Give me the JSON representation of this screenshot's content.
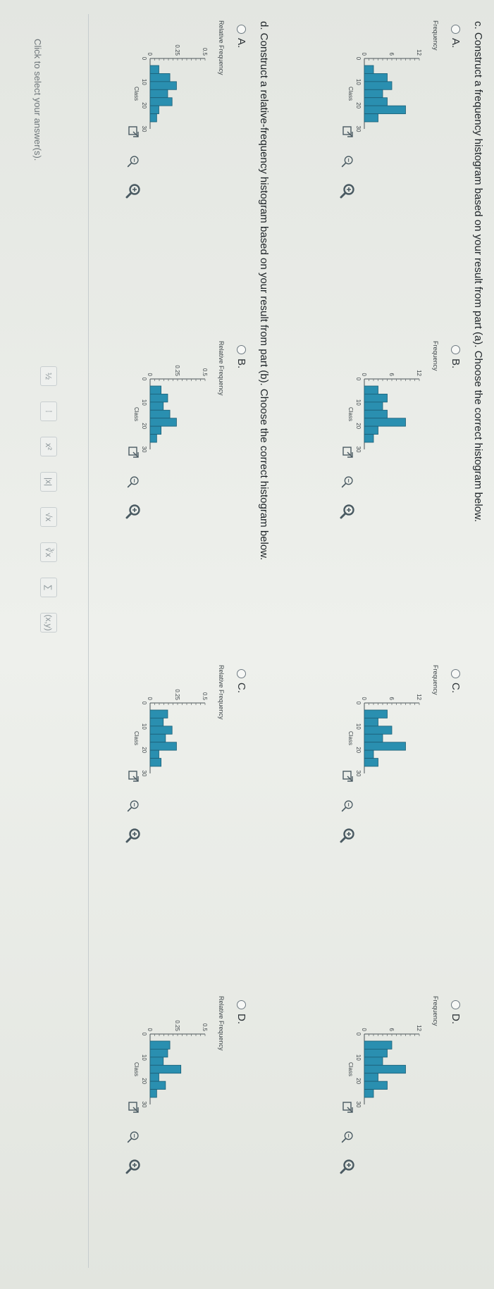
{
  "partC": {
    "question": "c. Construct a frequency histogram based on your result from part (a). Choose the correct histogram below.",
    "options": [
      {
        "letter": "A.",
        "ylabel": "Frequency",
        "yticks": [
          "12",
          "6",
          "0"
        ],
        "xticks": [
          "0",
          "10",
          "20",
          "30"
        ],
        "xlabel": "Class",
        "values": [
          2,
          5,
          6,
          4,
          5,
          9,
          3
        ]
      },
      {
        "letter": "B.",
        "ylabel": "Frequency",
        "yticks": [
          "12",
          "6",
          "0"
        ],
        "xticks": [
          "0",
          "10",
          "20",
          "30"
        ],
        "xlabel": "Class",
        "values": [
          3,
          5,
          4,
          5,
          9,
          3,
          2
        ]
      },
      {
        "letter": "C.",
        "ylabel": "Frequency",
        "yticks": [
          "12",
          "6",
          "0"
        ],
        "xticks": [
          "0",
          "10",
          "20",
          "30"
        ],
        "xlabel": "Class",
        "values": [
          5,
          3,
          6,
          4,
          9,
          2,
          3
        ]
      },
      {
        "letter": "D.",
        "ylabel": "Frequency",
        "yticks": [
          "12",
          "6",
          "0"
        ],
        "xticks": [
          "0",
          "10",
          "20",
          "30"
        ],
        "xlabel": "Class",
        "values": [
          6,
          5,
          4,
          9,
          3,
          5,
          2
        ]
      }
    ]
  },
  "partD": {
    "question": "d. Construct a relative-frequency histogram based on your result from part (b). Choose the correct histogram below.",
    "options": [
      {
        "letter": "A.",
        "ylabel": "Relative Frequency",
        "yticks": [
          "0.5",
          "0.25",
          "0"
        ],
        "xticks": [
          "0",
          "10",
          "20",
          "30"
        ],
        "xlabel": "Class",
        "values": [
          0.08,
          0.18,
          0.24,
          0.16,
          0.2,
          0.08,
          0.06
        ]
      },
      {
        "letter": "B.",
        "ylabel": "Relative Frequency",
        "yticks": [
          "0.5",
          "0.25",
          "0"
        ],
        "xticks": [
          "0",
          "10",
          "20",
          "30"
        ],
        "xlabel": "Class",
        "values": [
          0.1,
          0.16,
          0.12,
          0.18,
          0.24,
          0.1,
          0.06
        ]
      },
      {
        "letter": "C.",
        "ylabel": "Relative Frequency",
        "yticks": [
          "0.5",
          "0.25",
          "0"
        ],
        "xticks": [
          "0",
          "10",
          "20",
          "30"
        ],
        "xlabel": "Class",
        "values": [
          0.16,
          0.12,
          0.2,
          0.14,
          0.24,
          0.08,
          0.1
        ]
      },
      {
        "letter": "D.",
        "ylabel": "Relative Frequency",
        "yticks": [
          "0.5",
          "0.25",
          "0"
        ],
        "xticks": [
          "0",
          "10",
          "20",
          "30"
        ],
        "xlabel": "Class",
        "values": [
          0.18,
          0.16,
          0.12,
          0.28,
          0.08,
          0.14,
          0.06
        ]
      }
    ]
  },
  "footer": {
    "hint": "Click to select your answer(s).",
    "tools": [
      "½",
      "⁞",
      "x²",
      "|x|",
      "√x",
      "∛x",
      "∑",
      "(x,y)"
    ]
  },
  "colors": {
    "bar": "#2a8fb0",
    "bar_edge": "#1b5e76",
    "axis": "#4b5458",
    "icon": "#4a5a62",
    "accent": "#2f8ea8"
  },
  "icon_names": [
    "zoom-in-icon",
    "zoom-out-icon",
    "expand-icon"
  ]
}
